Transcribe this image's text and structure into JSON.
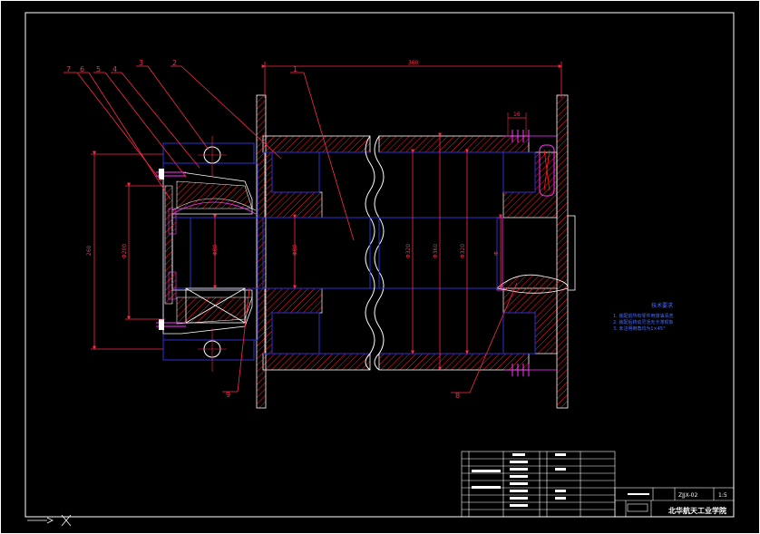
{
  "drawing": {
    "part_labels": [
      "7",
      "6",
      "5",
      "4",
      "3",
      "2",
      "1",
      "9",
      "8"
    ],
    "dimensions": {
      "overall_length": "360",
      "left_height": "260",
      "bore_left": "Φ200",
      "shaft_left": "Φ80",
      "shaft_mid": "Φ80",
      "inner_a": "Φ320",
      "inner_b": "Φ360",
      "inner_c": "Φ320",
      "right_small": "Φ",
      "pitch": "16"
    },
    "notes": {
      "title": "技术要求",
      "lines": [
        "1. 装配前所有零件用煤油清洗",
        "2. 装配后转动灵活无卡滞现象",
        "3. 未注明倒角均为1×45°"
      ]
    },
    "title_block": {
      "school": "北华航天工业学院",
      "drawing_no": "ZJJX-02",
      "scale": "1:5",
      "name": "卷筒装配图",
      "sheet": "共 张 第 张"
    },
    "colors": {
      "outline": "#ffffff",
      "section": "#ff2020",
      "body": "#2f2fd6",
      "dimension": "#ff2a4a",
      "note": "#4a6cff",
      "magenta": "#ff33ff"
    }
  }
}
